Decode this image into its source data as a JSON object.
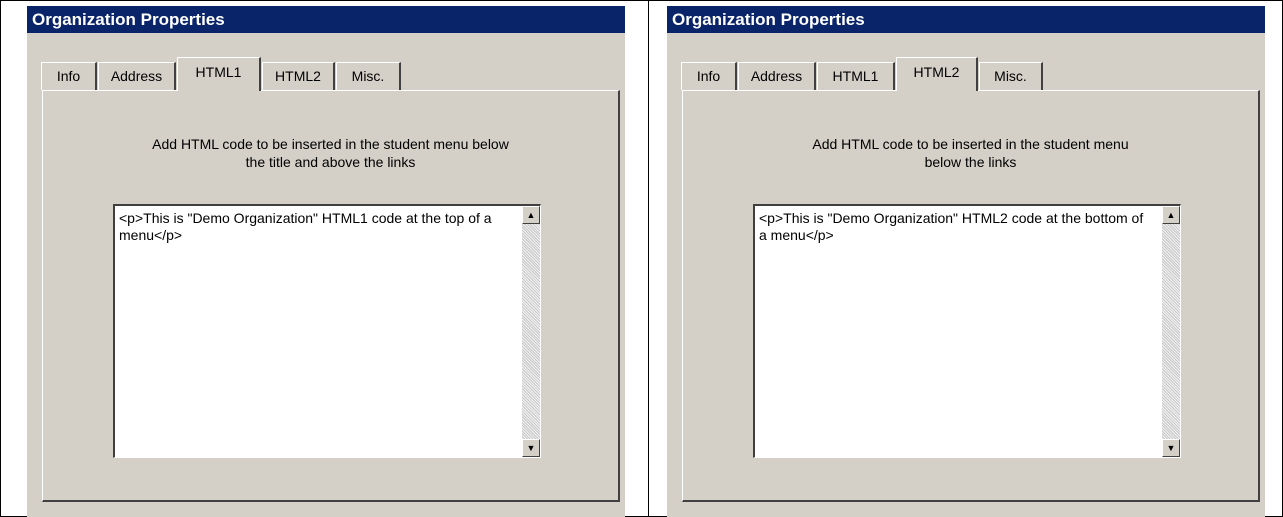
{
  "left_panel": {
    "title": "Organization Properties",
    "tabs": [
      {
        "label": "Info"
      },
      {
        "label": "Address"
      },
      {
        "label": "HTML1"
      },
      {
        "label": "HTML2"
      },
      {
        "label": "Misc."
      }
    ],
    "active_tab": "HTML1",
    "description_line1": "Add HTML code to be inserted in the student menu below",
    "description_line2": "the title and above the links",
    "code_value": "<p>This is \"Demo Organization\" HTML1 code at the top of a menu</p>"
  },
  "right_panel": {
    "title": "Organization Properties",
    "tabs": [
      {
        "label": "Info"
      },
      {
        "label": "Address"
      },
      {
        "label": "HTML1"
      },
      {
        "label": "HTML2"
      },
      {
        "label": "Misc."
      }
    ],
    "active_tab": "HTML2",
    "description_line1": "Add HTML code to be inserted in the student menu",
    "description_line2": "below the links",
    "code_value": "<p>This is \"Demo Organization\" HTML2 code at the bottom of a menu</p>"
  },
  "icons": {
    "scroll_up": "▲",
    "scroll_down": "▼"
  },
  "colors": {
    "titlebar": "#0a246a",
    "dialog_face": "#d4d0c8"
  }
}
